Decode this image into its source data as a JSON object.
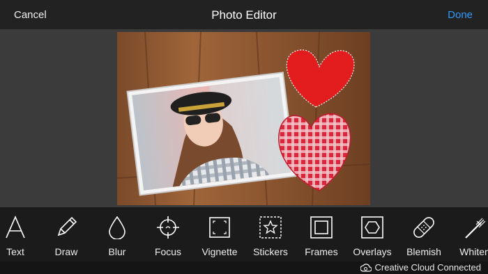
{
  "header": {
    "cancel_label": "Cancel",
    "title": "Photo Editor",
    "done_label": "Done"
  },
  "tools": [
    {
      "label": "Text",
      "icon": "text-icon"
    },
    {
      "label": "Draw",
      "icon": "pencil-icon"
    },
    {
      "label": "Blur",
      "icon": "droplet-icon"
    },
    {
      "label": "Focus",
      "icon": "crosshair-icon"
    },
    {
      "label": "Vignette",
      "icon": "vignette-icon"
    },
    {
      "label": "Stickers",
      "icon": "star-sticker-icon"
    },
    {
      "label": "Frames",
      "icon": "frame-icon"
    },
    {
      "label": "Overlays",
      "icon": "hexagon-overlay-icon"
    },
    {
      "label": "Blemish",
      "icon": "bandage-icon"
    },
    {
      "label": "Whiten",
      "icon": "toothbrush-icon"
    }
  ],
  "status": {
    "text": "Creative Cloud Connected",
    "icon": "creative-cloud-icon"
  },
  "colors": {
    "accent": "#2e9bff",
    "topbar": "#222222",
    "toolbar": "#1b1b1b"
  }
}
